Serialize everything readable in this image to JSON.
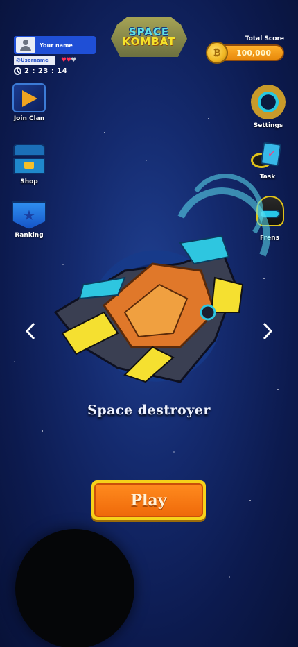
{
  "profile": {
    "name": "Your name",
    "username": "@Username",
    "hearts": {
      "full": 2,
      "total": 3
    },
    "timer": "2 : 23 : 14"
  },
  "logo": {
    "line1": "SPACE",
    "line2": "KOMBAT"
  },
  "score": {
    "label": "Total Score",
    "value": "100,000"
  },
  "left_menu": [
    {
      "label": "Join Clan",
      "icon": "clan-icon"
    },
    {
      "label": "Shop",
      "icon": "treasure-chest-icon"
    },
    {
      "label": "Ranking",
      "icon": "ranking-shield-icon"
    }
  ],
  "right_menu": [
    {
      "label": "Settings",
      "icon": "gear-icon"
    },
    {
      "label": "Task",
      "icon": "task-icon"
    },
    {
      "label": "Frens",
      "icon": "helmet-icon"
    }
  ],
  "ship": {
    "name": "Space destroyer"
  },
  "play": {
    "label": "Play"
  },
  "colors": {
    "background": "#142a6e",
    "accent_orange": "#ef6a0a",
    "accent_yellow": "#f6d21a",
    "accent_cyan": "#29c9e0"
  }
}
